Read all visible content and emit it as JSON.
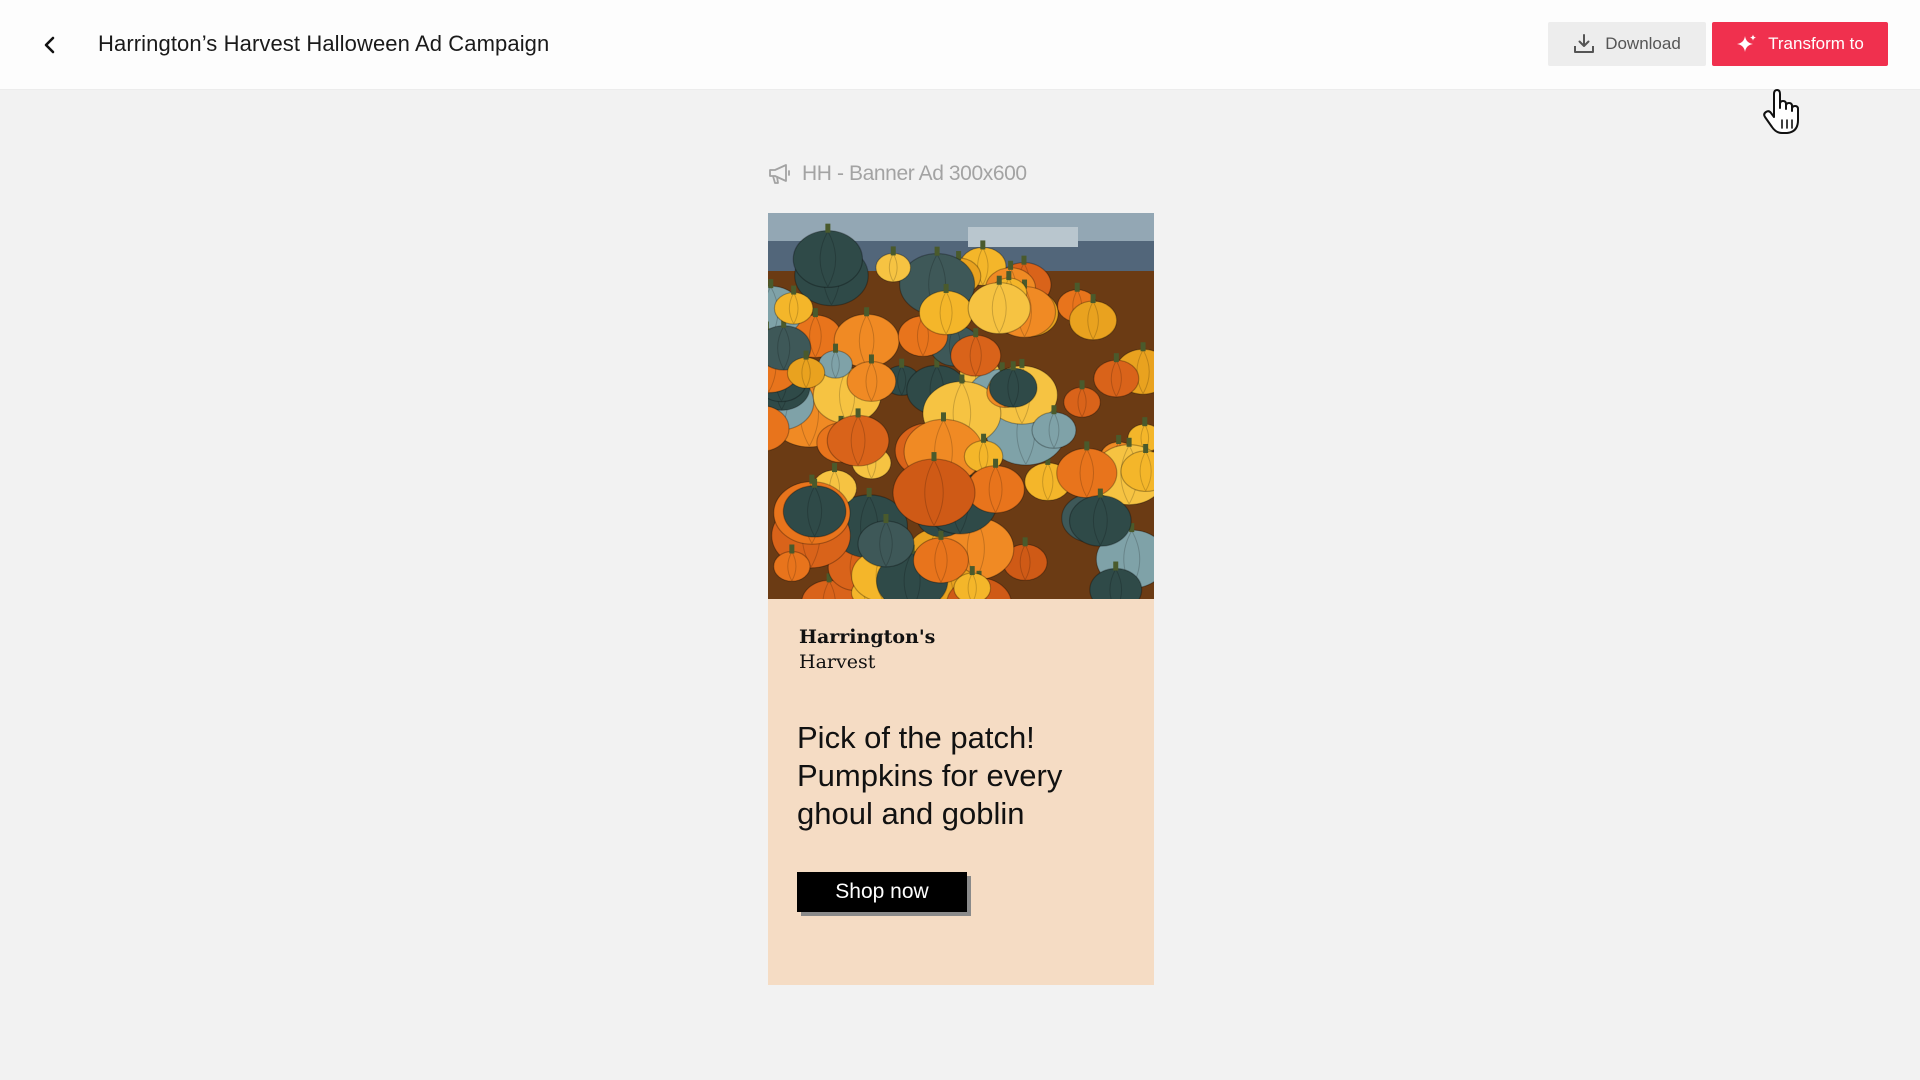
{
  "header": {
    "title": "Harrington’s Harvest Halloween Ad Campaign",
    "back_icon": "chevron-left-icon",
    "download_label": "Download",
    "download_icon": "download-icon",
    "transform_label": "Transform to",
    "transform_icon": "sparkle-icon"
  },
  "asset": {
    "label": "HH - Banner Ad 300x600",
    "icon": "megaphone-icon"
  },
  "ad": {
    "brand_name": "Harrington's",
    "brand_sub": "Harvest",
    "headline": "Pick of the patch! Pumpkins for every ghoul and goblin",
    "cta_label": "Shop now",
    "image": "pumpkins-photo"
  },
  "colors": {
    "accent": "#f0304e",
    "page_bg": "#f2f2f2",
    "ad_bg": "#f5dcc4",
    "cta_bg": "#000000"
  }
}
